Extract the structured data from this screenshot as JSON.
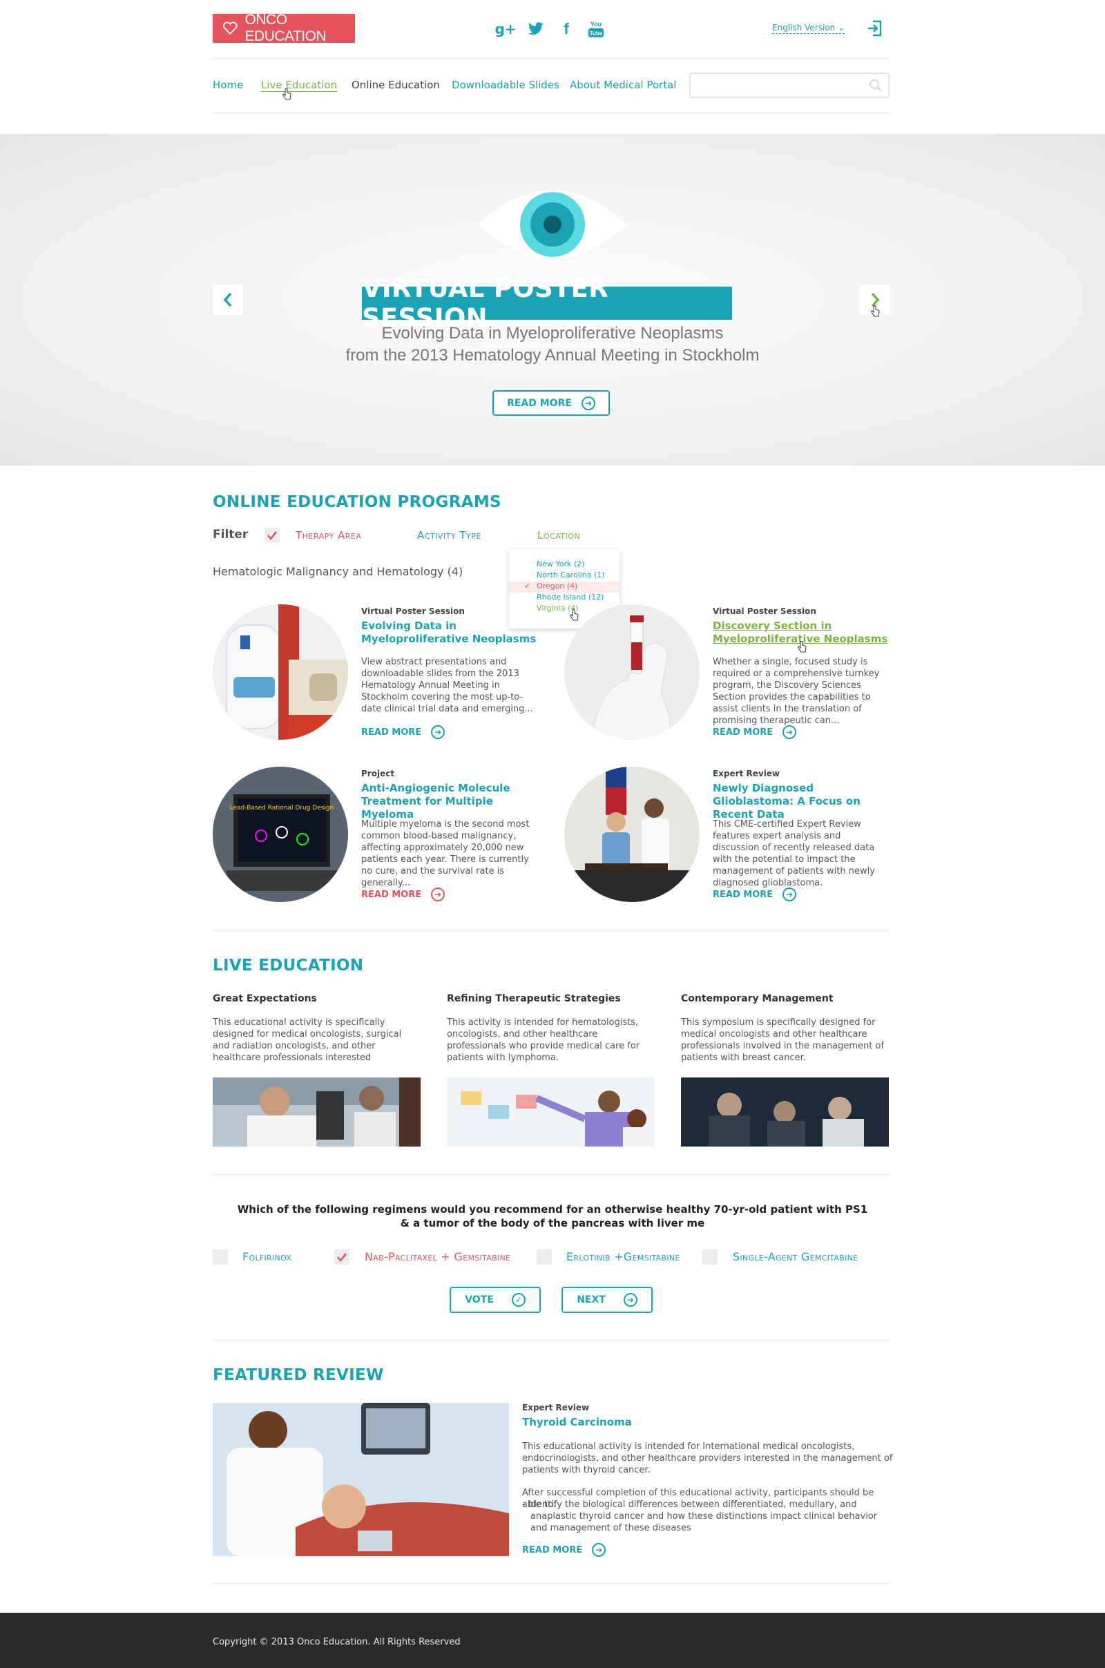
{
  "header": {
    "logo": "ONCO EDUCATION",
    "language": "English Version",
    "nav": [
      "Home",
      "Live Education",
      "Online Education",
      "Downloadable Slides",
      "About Medical Portal"
    ],
    "search_placeholder": ""
  },
  "hero": {
    "title": "VIRTUAL POSTER SESSION",
    "subtitle_1": "Evolving Data in Myeloproliferative Neoplasms",
    "subtitle_2": "from the 2013 Hematology Annual Meeting in Stockholm",
    "button": "READ MORE"
  },
  "programs": {
    "heading": "ONLINE EDUCATION PROGRAMS",
    "filter_label": "Filter",
    "filters": [
      "Therapy Area",
      "Activity Type",
      "Location"
    ],
    "category": "Hematologic Malignancy and Hematology (4)",
    "locations": [
      "New York (2)",
      "North Carolina (1)",
      "Oregon (4)",
      "Rhode Island (12)",
      "Virginia (4)"
    ],
    "cards": [
      {
        "type": "Virtual Poster Session",
        "title": "Evolving Data in Myeloproliferative Neoplasms",
        "desc": "View abstract presentations and downloadable slides from the 2013 Hematology Annual Meeting in Stockholm covering the most up-to-date clinical trial data and emerging...",
        "more": "READ MORE"
      },
      {
        "type": "Virtual Poster Session",
        "title": "Discovery Section in Myeloproliferative Neoplasms",
        "desc": "Whether a single, focused study is required or a comprehensive turnkey program, the Discovery Sciences Section provides the capabilities to assist clients in the translation of promising therapeutic can...",
        "more": "READ MORE"
      },
      {
        "type": "Project",
        "title": "Anti-Angiogenic Molecule Treatment for Multiple Myeloma",
        "desc": "Multiple myeloma is the second most common blood-based malignancy, affecting approximately 20,000 new patients each year. There is currently no cure, and the survival rate is generally...",
        "more": "READ MORE"
      },
      {
        "type": "Expert Review",
        "title": "Newly Diagnosed Glioblastoma: A Focus on Recent Data",
        "desc": "This CME-certified Expert Review features expert analysis and discussion of recently released data with the potential to impact the management of patients with newly diagnosed glioblastoma.",
        "more": "READ MORE"
      }
    ],
    "screen_caption": "Lead-Based Rational Drug Design"
  },
  "live": {
    "heading": "LIVE EDUCATION",
    "items": [
      {
        "title": "Great Expectations",
        "desc": "This educational activity is specifically designed for medical oncologists, surgical and radiation oncologists, and other healthcare professionals interested"
      },
      {
        "title": "Refining Therapeutic Strategies",
        "desc": "This activity is intended for hematologists, oncologists, and other healthcare professionals who provide medical care for patients with lymphoma."
      },
      {
        "title": "Contemporary Management",
        "desc": "This symposium is specifically designed for medical oncologists and other healthcare professionals involved in the management of patients with breast cancer."
      }
    ]
  },
  "poll": {
    "question": "Which of the following regimens would you recommend for an otherwise healthy 70-yr-old patient with PS1 & a tumor of the body of the pancreas with liver me",
    "options": [
      "Folfirinox",
      "Nab-Paclitaxel + Gemsitabine",
      "Erlotinib +Gemsitabine",
      "Single-Agent Gemcitabine"
    ],
    "vote": "VOTE",
    "next": "NEXT"
  },
  "featured": {
    "heading": "FEATURED REVIEW",
    "type": "Expert Review",
    "title": "Thyroid Carcinoma",
    "desc1": "This educational activity is intended for International medical oncologists, endocrinologists, and other healthcare providers interested in the management of patients with thyroid cancer.",
    "desc2": "After successful completion of this educational activity, participants should be able to:",
    "bullet": "- Identify the biological differences between differentiated, medullary, and anaplastic thyroid cancer and how these distinctions impact clinical behavior and management of these diseases",
    "more": "READ MORE"
  },
  "footer": {
    "copyright": "Copyright © 2013 Onco Education. All Rights Reserved"
  },
  "colors": {
    "accent": "#1aa3b5",
    "brand": "#e5535c",
    "green": "#7ab342"
  }
}
